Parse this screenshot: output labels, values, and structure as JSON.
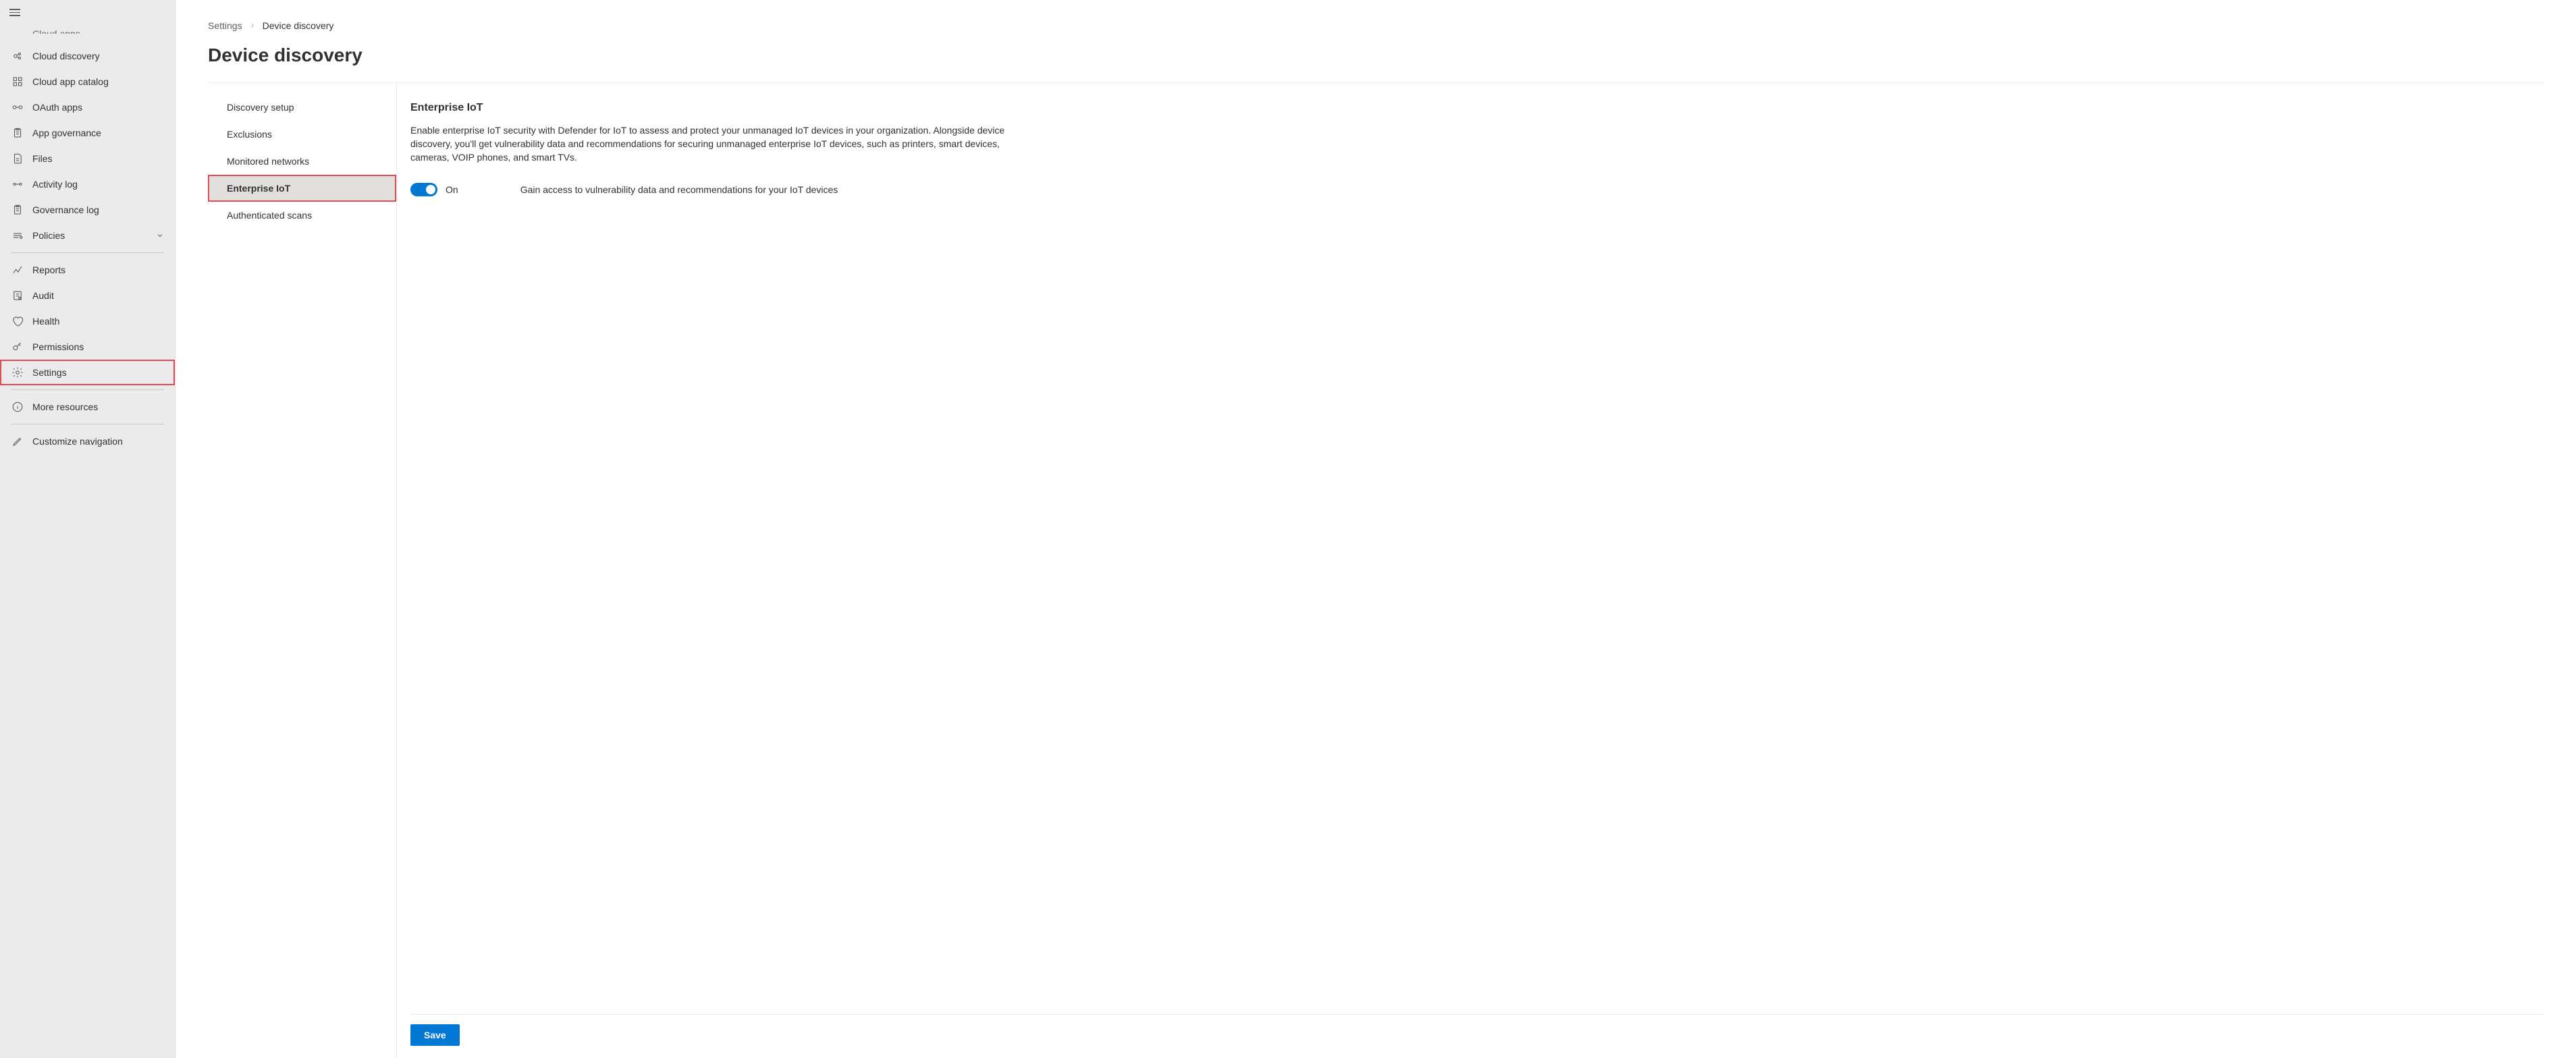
{
  "sidebar": {
    "items": [
      {
        "label": "Cloud apps",
        "icon": "cloud-apps"
      },
      {
        "label": "Cloud discovery",
        "icon": "cloud-discovery"
      },
      {
        "label": "Cloud app catalog",
        "icon": "catalog"
      },
      {
        "label": "OAuth apps",
        "icon": "oauth"
      },
      {
        "label": "App governance",
        "icon": "clipboard"
      },
      {
        "label": "Files",
        "icon": "files"
      },
      {
        "label": "Activity log",
        "icon": "activity"
      },
      {
        "label": "Governance log",
        "icon": "clipboard"
      },
      {
        "label": "Policies",
        "icon": "policies",
        "expandable": true
      },
      {
        "divider": true
      },
      {
        "label": "Reports",
        "icon": "reports"
      },
      {
        "label": "Audit",
        "icon": "audit"
      },
      {
        "label": "Health",
        "icon": "health"
      },
      {
        "label": "Permissions",
        "icon": "permissions"
      },
      {
        "label": "Settings",
        "icon": "settings",
        "highlight": true
      },
      {
        "divider": true
      },
      {
        "label": "More resources",
        "icon": "info"
      },
      {
        "divider": true
      },
      {
        "label": "Customize navigation",
        "icon": "edit"
      }
    ]
  },
  "breadcrumb": {
    "items": [
      "Settings",
      "Device discovery"
    ]
  },
  "page": {
    "title": "Device discovery"
  },
  "settings_nav": {
    "items": [
      {
        "label": "Discovery setup"
      },
      {
        "label": "Exclusions"
      },
      {
        "label": "Monitored networks"
      },
      {
        "label": "Enterprise IoT",
        "active": true,
        "highlight": true
      },
      {
        "label": "Authenticated scans"
      }
    ]
  },
  "detail": {
    "title": "Enterprise IoT",
    "description": "Enable enterprise IoT security with Defender for IoT to assess and protect your unmanaged IoT devices in your organization. Alongside device discovery, you'll get vulnerability data and recommendations for securing unmanaged enterprise IoT devices, such as printers, smart devices, cameras, VOIP phones, and smart TVs.",
    "toggle": {
      "state": "On",
      "info": "Gain access to vulnerability data and recommendations for your IoT devices"
    }
  },
  "footer": {
    "save_label": "Save"
  }
}
